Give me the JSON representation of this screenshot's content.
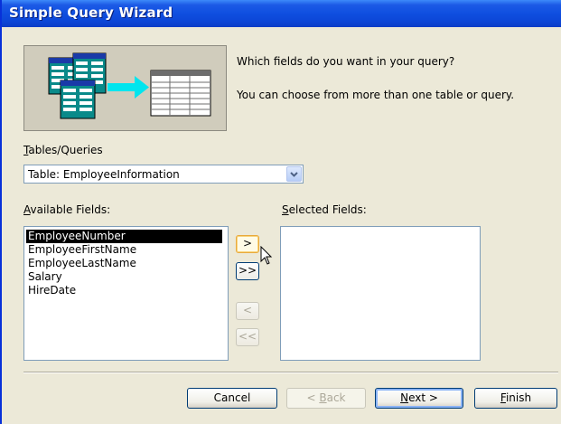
{
  "window": {
    "title": "Simple Query Wizard"
  },
  "prompt": {
    "line1": "Which fields do you want in your query?",
    "line2": "You can choose from more than one table or query."
  },
  "tables_queries": {
    "label_accel": "T",
    "label_rest": "ables/Queries",
    "selected": "Table: EmployeeInformation"
  },
  "available_fields": {
    "label_accel": "A",
    "label_rest": "vailable Fields:",
    "items": [
      "EmployeeNumber",
      "EmployeeFirstName",
      "EmployeeLastName",
      "Salary",
      "HireDate"
    ],
    "selected_item": "EmployeeNumber"
  },
  "selected_fields": {
    "label_accel": "S",
    "label_rest": "elected Fields:",
    "items": []
  },
  "move_buttons": {
    "add_one": ">",
    "add_all": ">>",
    "remove_one": "<",
    "remove_all": "<<"
  },
  "footer": {
    "cancel": "Cancel",
    "back_pre": "< ",
    "back_accel": "B",
    "back_rest": "ack",
    "next_accel": "N",
    "next_rest": "ext >",
    "finish_accel": "F",
    "finish_rest": "inish"
  },
  "colors": {
    "titlebar": "#0f4fe0",
    "dialog_bg": "#ece9d8",
    "list_selection": "#000000"
  }
}
